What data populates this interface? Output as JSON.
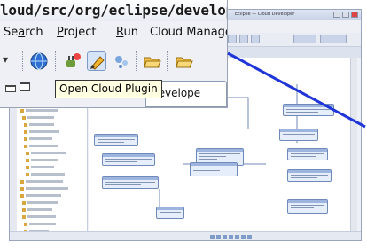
{
  "magnifier": {
    "title_path": "loud/src/org/eclipse/developer/cl",
    "menu": {
      "search": {
        "label_pre": "Se",
        "label_ul": "a",
        "label_post": "rch"
      },
      "project": {
        "label_ul": "P",
        "label_post": "roject"
      },
      "run": {
        "label_ul": "R",
        "label_post": "un"
      },
      "cloud_manager": {
        "label": "Cloud Manager"
      }
    },
    "tooltip": "Open Cloud Plugin",
    "view_tab_label": "develope"
  },
  "ide": {
    "title_text": "Eclipse — Cloud Developer",
    "accent_color": "#2035d8"
  }
}
